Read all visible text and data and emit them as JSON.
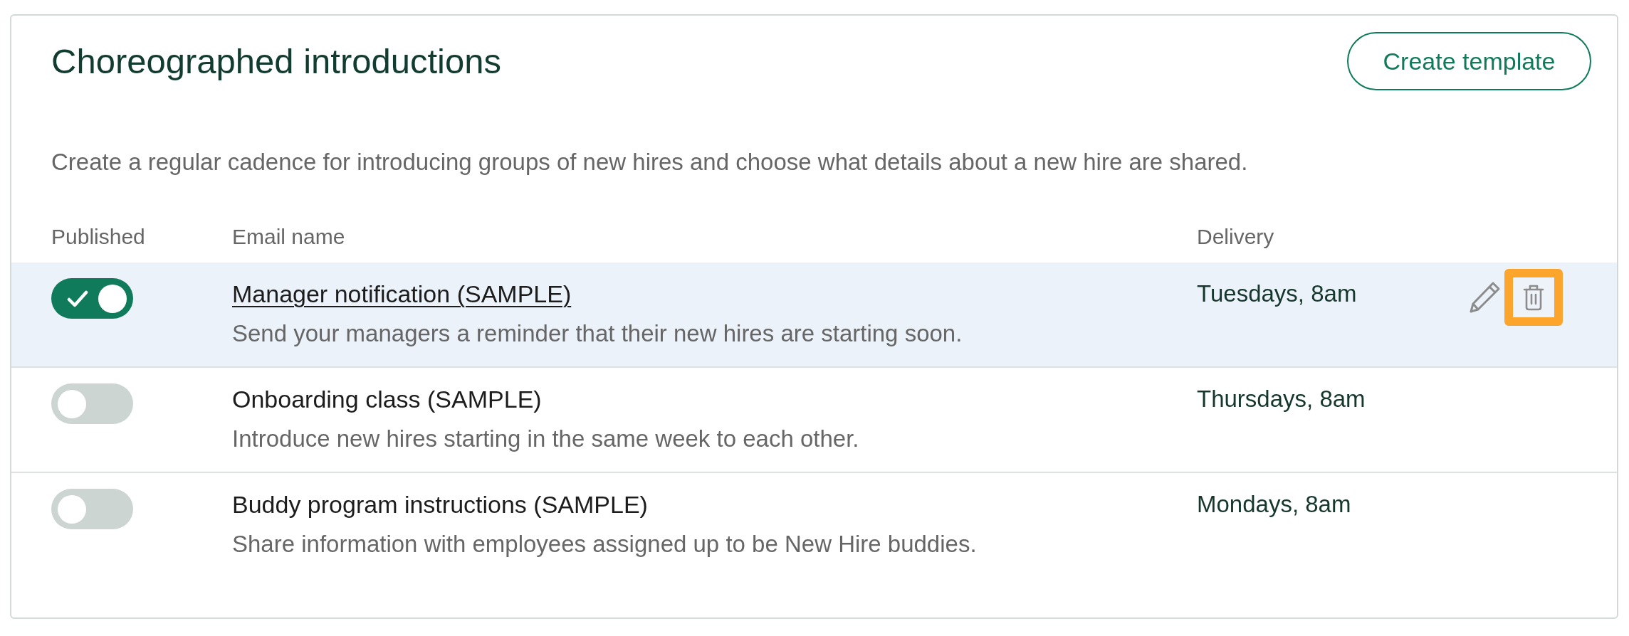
{
  "header": {
    "title": "Choreographed introductions",
    "button": "Create template"
  },
  "description": "Create a regular cadence for introducing groups of new hires and choose what details about a new hire are shared.",
  "table": {
    "columns": [
      "Published",
      "Email name",
      "Delivery"
    ],
    "rows": [
      {
        "published": true,
        "hovered": true,
        "name": "Manager notification (SAMPLE)",
        "description": "Send your managers a reminder that their new hires are starting soon.",
        "delivery": "Tuesdays, 8am",
        "actions": [
          {
            "kind": "edit",
            "highlighted": false
          },
          {
            "kind": "delete",
            "highlighted": true
          }
        ]
      },
      {
        "published": false,
        "hovered": false,
        "name": "Onboarding class (SAMPLE)",
        "description": "Introduce new hires starting in the same week to each other.",
        "delivery": "Thursdays, 8am"
      },
      {
        "published": false,
        "hovered": false,
        "name": "Buddy program instructions (SAMPLE)",
        "description": "Share information with employees assigned up to be New Hire buddies.",
        "delivery": "Mondays, 8am"
      }
    ]
  }
}
